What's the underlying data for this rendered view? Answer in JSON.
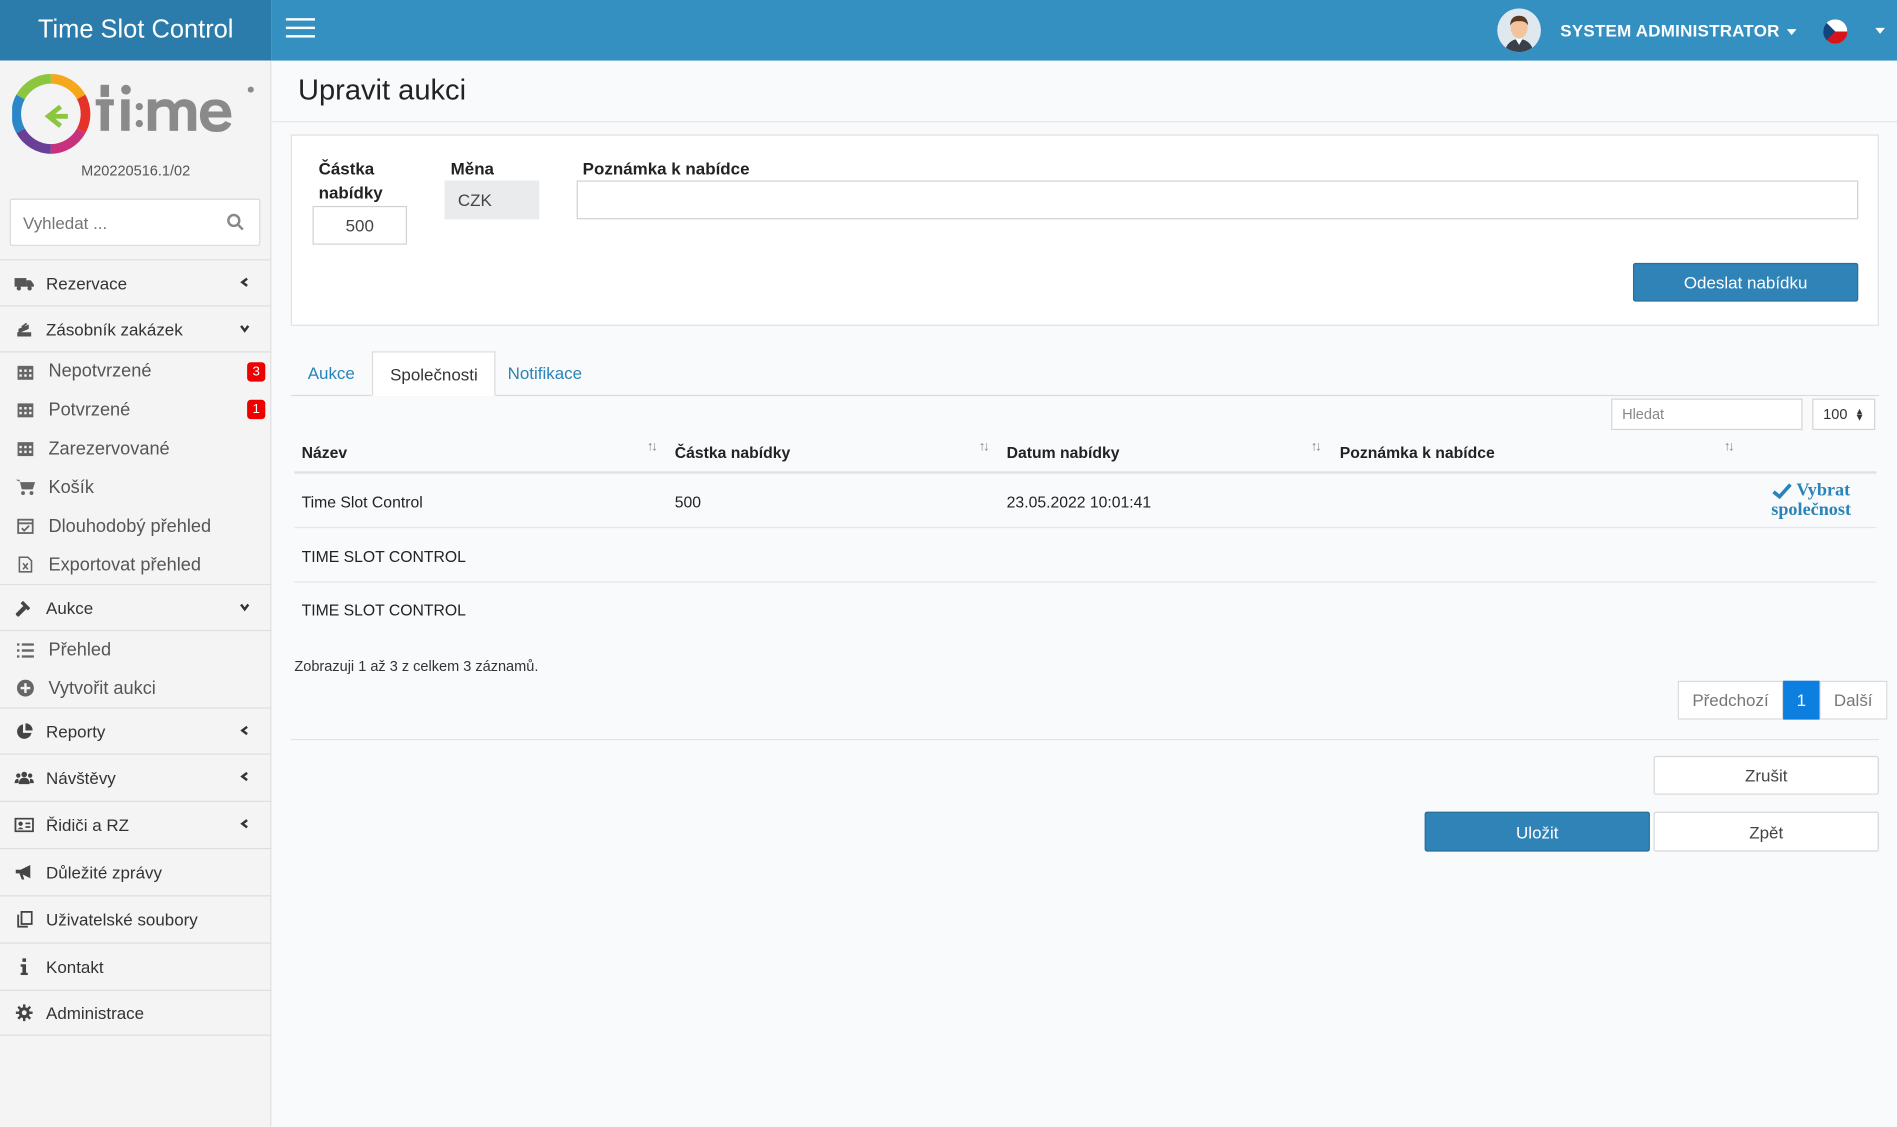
{
  "app": {
    "title": "Time Slot Control",
    "version": "M20220516.1/02"
  },
  "topbar": {
    "user_name": "SYSTEM ADMINISTRATOR",
    "menu_icon": "hamburger-icon",
    "language": "CZ"
  },
  "sidebar": {
    "search_placeholder": "Vyhledat ...",
    "items": [
      {
        "label": "Rezervace",
        "icon": "truck-icon",
        "chevron": "left"
      },
      {
        "label": "Zásobník zakázek",
        "icon": "stack-icon",
        "chevron": "down"
      },
      {
        "label": "Nepotvrzené",
        "icon": "calendar-icon",
        "badge": "3"
      },
      {
        "label": "Potvrzené",
        "icon": "calendar-icon",
        "badge": "1"
      },
      {
        "label": "Zarezervované",
        "icon": "calendar-icon"
      },
      {
        "label": "Košík",
        "icon": "cart-icon"
      },
      {
        "label": "Dlouhodobý přehled",
        "icon": "calendar-check-icon"
      },
      {
        "label": "Exportovat přehled",
        "icon": "excel-icon"
      },
      {
        "label": "Aukce",
        "icon": "gavel-icon",
        "chevron": "down"
      },
      {
        "label": "Přehled",
        "icon": "list-icon"
      },
      {
        "label": "Vytvořit aukci",
        "icon": "plus-circle-icon"
      },
      {
        "label": "Reporty",
        "icon": "pie-chart-icon",
        "chevron": "left"
      },
      {
        "label": "Návštěvy",
        "icon": "users-icon",
        "chevron": "left"
      },
      {
        "label": "Řidiči a RZ",
        "icon": "id-card-icon",
        "chevron": "left"
      },
      {
        "label": "Důležité zprávy",
        "icon": "megaphone-icon"
      },
      {
        "label": "Uživatelské soubory",
        "icon": "files-icon"
      },
      {
        "label": "Kontakt",
        "icon": "info-icon"
      },
      {
        "label": "Administrace",
        "icon": "gear-icon"
      }
    ]
  },
  "page": {
    "title": "Upravit aukci"
  },
  "form": {
    "amount_label_1": "Částka",
    "amount_label_2": "nabídky",
    "amount_value": "500",
    "currency_label": "Měna",
    "currency_value": "CZK",
    "note_label": "Poznámka k nabídce",
    "note_value": "",
    "submit_label": "Odeslat nabídku"
  },
  "tabs": [
    {
      "label": "Aukce",
      "active": false
    },
    {
      "label": "Společnosti",
      "active": true
    },
    {
      "label": "Notifikace",
      "active": false
    }
  ],
  "table": {
    "search_placeholder": "Hledat",
    "page_length": "100",
    "columns": [
      "Název",
      "Částka nabídky",
      "Datum nabídky",
      "Poznámka k nabídce"
    ],
    "rows": [
      {
        "name": "Time Slot Control",
        "amount": "500",
        "date": "23.05.2022 10:01:41",
        "note": "",
        "action_1": "Vybrat",
        "action_2": "společnost"
      },
      {
        "name": "TIME SLOT CONTROL",
        "amount": "",
        "date": "",
        "note": ""
      },
      {
        "name": "TIME SLOT CONTROL",
        "amount": "",
        "date": "",
        "note": ""
      }
    ],
    "info": "Zobrazuji 1 až 3 z celkem 3 záznamů.",
    "pager": {
      "prev": "Předchozí",
      "current": "1",
      "next": "Další"
    }
  },
  "actions": {
    "cancel": "Zrušit",
    "save": "Uložit",
    "back": "Zpět"
  },
  "colors": {
    "brand": "#2b7cab",
    "topbar": "#3490c1",
    "primary": "#2f83b7",
    "badge": "#ee0000",
    "pager_active": "#0d7fe0"
  }
}
